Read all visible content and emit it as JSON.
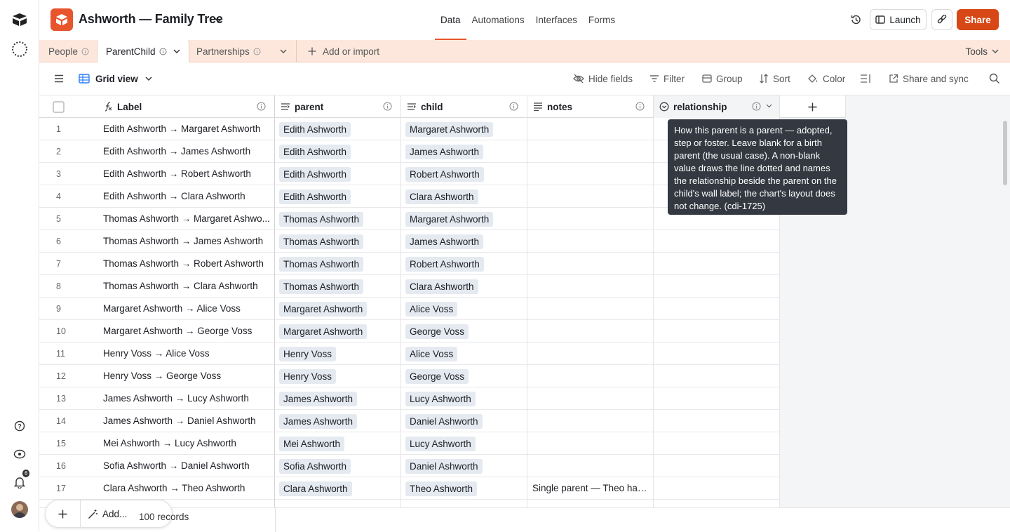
{
  "app": {
    "base_name": "Ashworth — Family Tree",
    "colors": {
      "accent": "#e8542c",
      "share": "#d74816",
      "tablebar": "#fde7dc"
    }
  },
  "nav": {
    "tabs": [
      {
        "label": "Data",
        "active": true
      },
      {
        "label": "Automations"
      },
      {
        "label": "Interfaces"
      },
      {
        "label": "Forms"
      }
    ],
    "launch_label": "Launch",
    "share_label": "Share"
  },
  "tables": {
    "items": [
      {
        "label": "People"
      },
      {
        "label": "ParentChild",
        "active": true
      },
      {
        "label": "Partnerships"
      }
    ],
    "add_label": "Add or import",
    "tools_label": "Tools"
  },
  "view": {
    "name": "Grid view",
    "hide_fields": "Hide fields",
    "filter": "Filter",
    "group": "Group",
    "sort": "Sort",
    "color": "Color",
    "share_sync": "Share and sync"
  },
  "columns": {
    "label": "Label",
    "parent": "parent",
    "child": "child",
    "notes": "notes",
    "relationship": "relationship"
  },
  "rows": [
    {
      "n": "1",
      "label": "Edith Ashworth → Margaret Ashworth",
      "parent": "Edith Ashworth",
      "child": "Margaret Ashworth",
      "notes": ""
    },
    {
      "n": "2",
      "label": "Edith Ashworth → James Ashworth",
      "parent": "Edith Ashworth",
      "child": "James Ashworth",
      "notes": ""
    },
    {
      "n": "3",
      "label": "Edith Ashworth → Robert Ashworth",
      "parent": "Edith Ashworth",
      "child": "Robert Ashworth",
      "notes": ""
    },
    {
      "n": "4",
      "label": "Edith Ashworth → Clara Ashworth",
      "parent": "Edith Ashworth",
      "child": "Clara Ashworth",
      "notes": ""
    },
    {
      "n": "5",
      "label": "Thomas Ashworth → Margaret Ashwo...",
      "parent": "Thomas Ashworth",
      "child": "Margaret Ashworth",
      "notes": ""
    },
    {
      "n": "6",
      "label": "Thomas Ashworth → James Ashworth",
      "parent": "Thomas Ashworth",
      "child": "James Ashworth",
      "notes": ""
    },
    {
      "n": "7",
      "label": "Thomas Ashworth → Robert Ashworth",
      "parent": "Thomas Ashworth",
      "child": "Robert Ashworth",
      "notes": ""
    },
    {
      "n": "8",
      "label": "Thomas Ashworth → Clara Ashworth",
      "parent": "Thomas Ashworth",
      "child": "Clara Ashworth",
      "notes": ""
    },
    {
      "n": "9",
      "label": "Margaret Ashworth → Alice Voss",
      "parent": "Margaret Ashworth",
      "child": "Alice Voss",
      "notes": ""
    },
    {
      "n": "10",
      "label": "Margaret Ashworth → George Voss",
      "parent": "Margaret Ashworth",
      "child": "George Voss",
      "notes": ""
    },
    {
      "n": "11",
      "label": "Henry Voss → Alice Voss",
      "parent": "Henry Voss",
      "child": "Alice Voss",
      "notes": ""
    },
    {
      "n": "12",
      "label": "Henry Voss → George Voss",
      "parent": "Henry Voss",
      "child": "George Voss",
      "notes": ""
    },
    {
      "n": "13",
      "label": "James Ashworth → Lucy Ashworth",
      "parent": "James Ashworth",
      "child": "Lucy Ashworth",
      "notes": ""
    },
    {
      "n": "14",
      "label": "James Ashworth → Daniel Ashworth",
      "parent": "James Ashworth",
      "child": "Daniel Ashworth",
      "notes": ""
    },
    {
      "n": "15",
      "label": "Mei Ashworth → Lucy Ashworth",
      "parent": "Mei Ashworth",
      "child": "Lucy Ashworth",
      "notes": ""
    },
    {
      "n": "16",
      "label": "Sofia Ashworth → Daniel Ashworth",
      "parent": "Sofia Ashworth",
      "child": "Daniel Ashworth",
      "notes": ""
    },
    {
      "n": "17",
      "label": "Clara Ashworth → Theo Ashworth",
      "parent": "Clara Ashworth",
      "child": "Theo Ashworth",
      "notes": "Single parent — Theo has..."
    }
  ],
  "footer": {
    "add_label": "Add...",
    "record_count": "100 records"
  },
  "notifications_count": "6",
  "tooltip": "How this parent is a parent — adopted, step or foster. Leave blank for a birth parent (the usual case). A non-blank value draws the line dotted and names the relationship beside the parent on the child's wall label; the chart's layout does not change. (cdi-1725)"
}
